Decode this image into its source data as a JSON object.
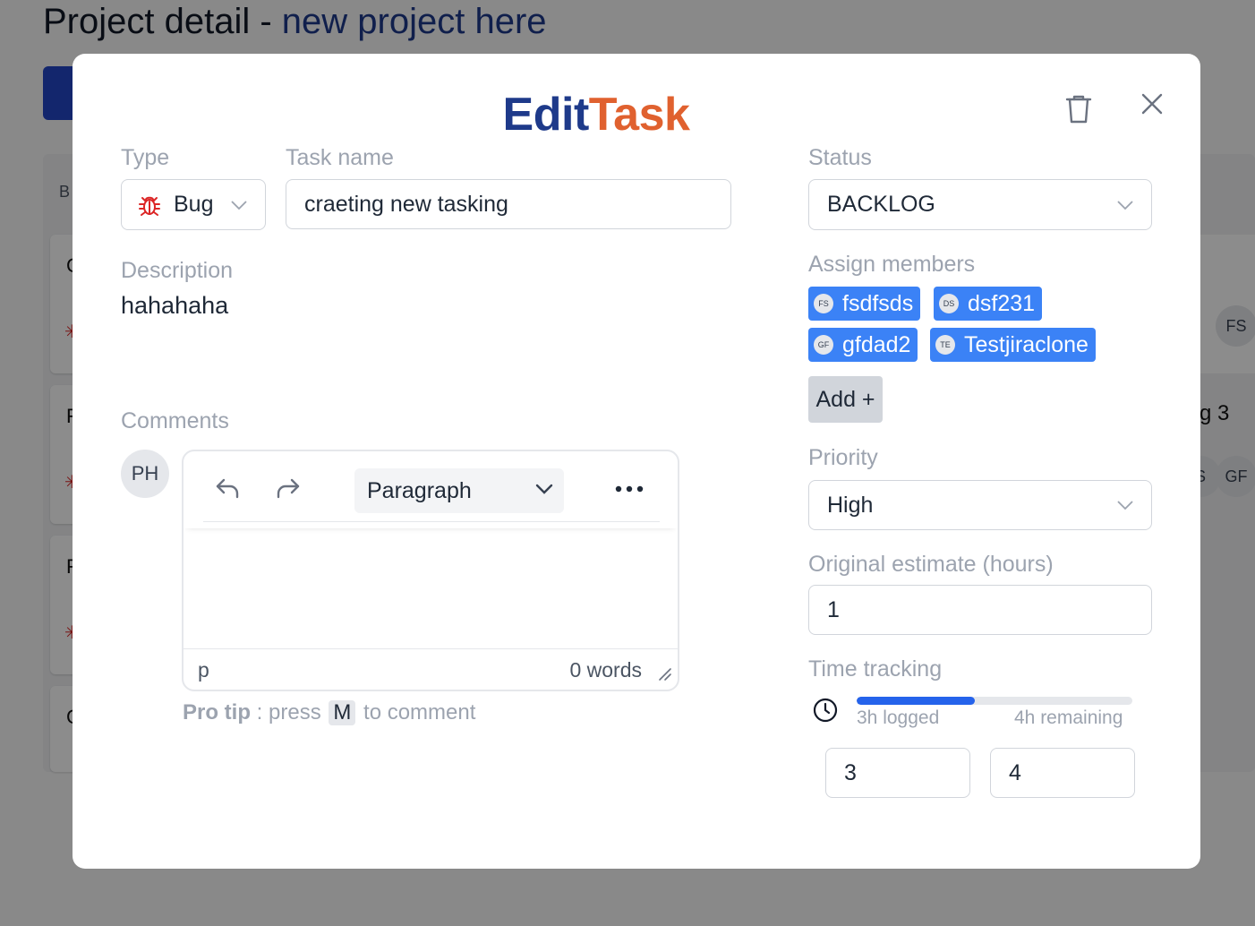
{
  "background": {
    "page_title_prefix": "Project detail - ",
    "project_name": "new project here",
    "column_label_fragment": "B",
    "card_letters": [
      "C",
      "F",
      "F",
      "C"
    ],
    "right_card_text": "g 3",
    "avatars": [
      "FS",
      "S",
      "GF"
    ]
  },
  "modal": {
    "title_part1": "Edit",
    "title_part2": "Task",
    "type": {
      "label": "Type",
      "value": "Bug"
    },
    "task_name": {
      "label": "Task name",
      "value": "craeting new tasking"
    },
    "description": {
      "label": "Description",
      "value": "hahahaha"
    },
    "comments": {
      "label": "Comments",
      "avatar": "PH",
      "block_type": "Paragraph",
      "path": "p",
      "word_count": "0 words",
      "pro_tip_bold": "Pro tip",
      "pro_tip_mid": " : press ",
      "pro_tip_key": "M",
      "pro_tip_end": " to comment"
    },
    "status": {
      "label": "Status",
      "value": "BACKLOG"
    },
    "assign": {
      "label": "Assign members",
      "members": [
        {
          "initials": "FS",
          "name": "fsdfsds"
        },
        {
          "initials": "DS",
          "name": "dsf231"
        },
        {
          "initials": "GF",
          "name": "gfdad2"
        },
        {
          "initials": "TE",
          "name": "Testjiraclone"
        }
      ],
      "add_label": "Add +"
    },
    "priority": {
      "label": "Priority",
      "value": "High"
    },
    "estimate": {
      "label": "Original estimate (hours)",
      "value": "1"
    },
    "time_tracking": {
      "label": "Time tracking",
      "logged_text": "3h logged",
      "remaining_text": "4h remaining",
      "logged_value": "3",
      "remaining_value": "4",
      "progress_fraction": 0.43
    }
  },
  "colors": {
    "accent": "#3b82f6",
    "title_blue": "#1e3a8a",
    "title_orange": "#e0612f",
    "bug_red": "#dc2626"
  }
}
